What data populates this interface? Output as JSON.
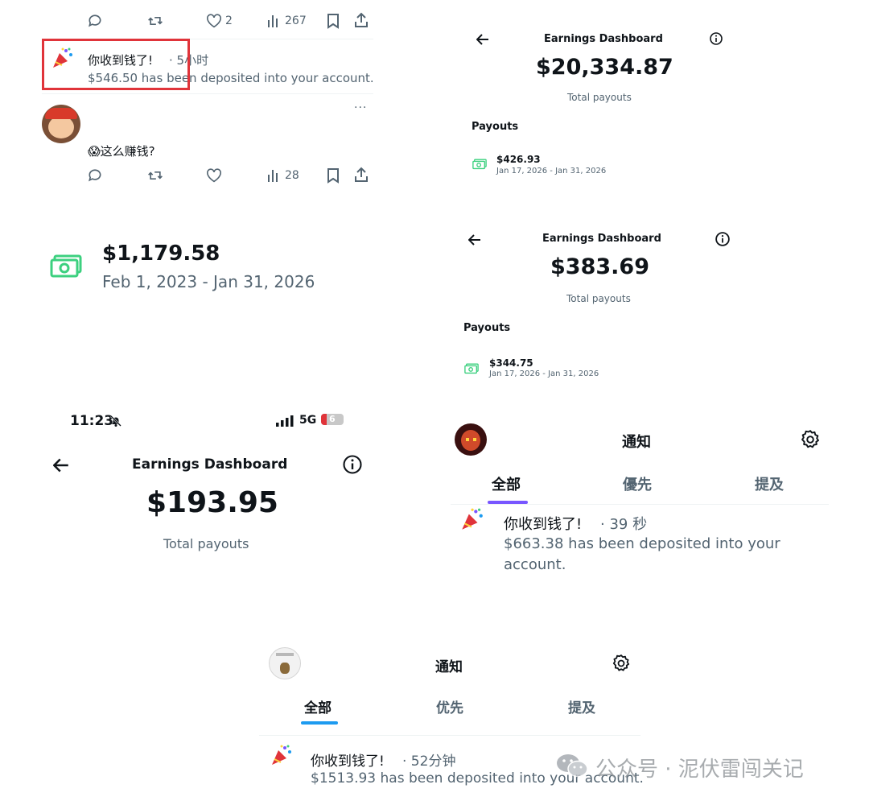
{
  "colors": {
    "accent_purple": "#7856ff",
    "accent_blue": "#1d9bf0",
    "highlight_red": "#e0343a",
    "cash_green": "#3cd07f",
    "muted": "#536471"
  },
  "tweet_actions_top": {
    "likes": "2",
    "views": "267"
  },
  "notif_top": {
    "title": "你收到钱了!",
    "time": "· 5小时",
    "body": "$546.50 has been deposited into your account."
  },
  "tweet2": {
    "text": "😱这么赚钱?",
    "views": "28",
    "more": "···"
  },
  "dash_a": {
    "title": "Earnings Dashboard",
    "amount": "$20,334.87",
    "subtitle": "Total payouts",
    "section": "Payouts",
    "payout_amount": "$426.93",
    "payout_range": "Jan 17, 2026 - Jan 31, 2026"
  },
  "dash_b": {
    "title": "Earnings Dashboard",
    "amount": "$383.69",
    "subtitle": "Total payouts",
    "section": "Payouts",
    "payout_amount": "$344.75",
    "payout_range": "Jan 17, 2026 - Jan 31, 2026"
  },
  "big_payout": {
    "amount": "$1,179.58",
    "range": "Feb 1, 2023 - Jan 31, 2026"
  },
  "phone": {
    "time": "11:23",
    "network": "5G",
    "battery": "6",
    "title": "Earnings Dashboard",
    "amount": "$193.95",
    "subtitle": "Total payouts"
  },
  "notif_panel_a": {
    "title": "通知",
    "tabs": [
      "全部",
      "優先",
      "提及"
    ],
    "notif_title": "你收到钱了!",
    "notif_time": "· 39 秒",
    "notif_body_line1": "$663.38 has been deposited into your",
    "notif_body_line2": "account."
  },
  "notif_panel_b": {
    "title": "通知",
    "tabs": [
      "全部",
      "优先",
      "提及"
    ],
    "notif_title": "你收到钱了!",
    "notif_time": "· 52分钟",
    "notif_body": "$1513.93 has been deposited into your account."
  },
  "watermark": {
    "text": "公众号 · 泥伏雷闯关记"
  },
  "icons": [
    "reply-icon",
    "retweet-icon",
    "like-icon",
    "views-icon",
    "bookmark-icon",
    "share-icon",
    "back-arrow-icon",
    "info-icon",
    "cash-icon",
    "party-popper-icon",
    "settings-gear-icon",
    "avatar",
    "signal-icon",
    "mute-bell-icon",
    "wechat-icon"
  ]
}
